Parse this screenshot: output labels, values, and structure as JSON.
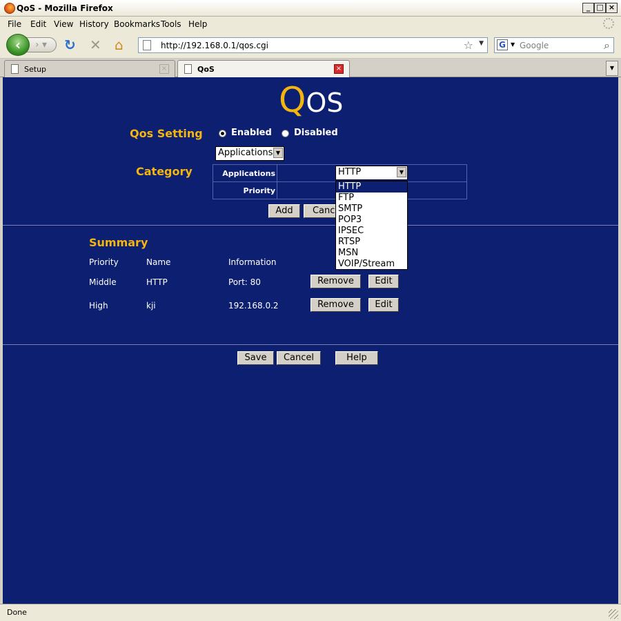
{
  "window": {
    "title": "QoS - Mozilla Firefox",
    "min_label": "_",
    "max_label": "□",
    "close_label": "×"
  },
  "menu": [
    "File",
    "Edit",
    "View",
    "History",
    "Bookmarks",
    "Tools",
    "Help"
  ],
  "nav": {
    "url": "http://192.168.0.1/qos.cgi",
    "search_placeholder": "Google",
    "search_engine": "G"
  },
  "tabs": [
    {
      "label": "Setup",
      "active": false
    },
    {
      "label": "QoS",
      "active": true
    }
  ],
  "page": {
    "title_q": "Q",
    "title_rest": "OS",
    "qos_setting_label": "Qos Setting",
    "enabled_label": "Enabled",
    "disabled_label": "Disabled",
    "mode": "Enabled",
    "category_label": "Category",
    "category_select": "Applications",
    "applications_label": "Applications",
    "priority_label": "Priority",
    "app_select": "HTTP",
    "app_options": [
      "HTTP",
      "FTP",
      "SMTP",
      "POP3",
      "IPSEC",
      "RTSP",
      "MSN",
      "VOIP/Stream"
    ],
    "add_button": "Add",
    "cancel_button": "Cancel",
    "summary_label": "Summary",
    "columns": [
      "Priority",
      "Name",
      "Information"
    ],
    "rows": [
      {
        "priority": "Middle",
        "name": "HTTP",
        "info": "Port: 80",
        "remove": "Remove",
        "edit": "Edit"
      },
      {
        "priority": "High",
        "name": "kji",
        "info": "192.168.0.2",
        "remove": "Remove",
        "edit": "Edit"
      }
    ],
    "save_button": "Save",
    "cancel2_button": "Cancel",
    "help_button": "Help"
  },
  "status": {
    "text": "Done"
  },
  "colors": {
    "page_bg": "#0d1f71",
    "accent": "#f5b50f"
  }
}
